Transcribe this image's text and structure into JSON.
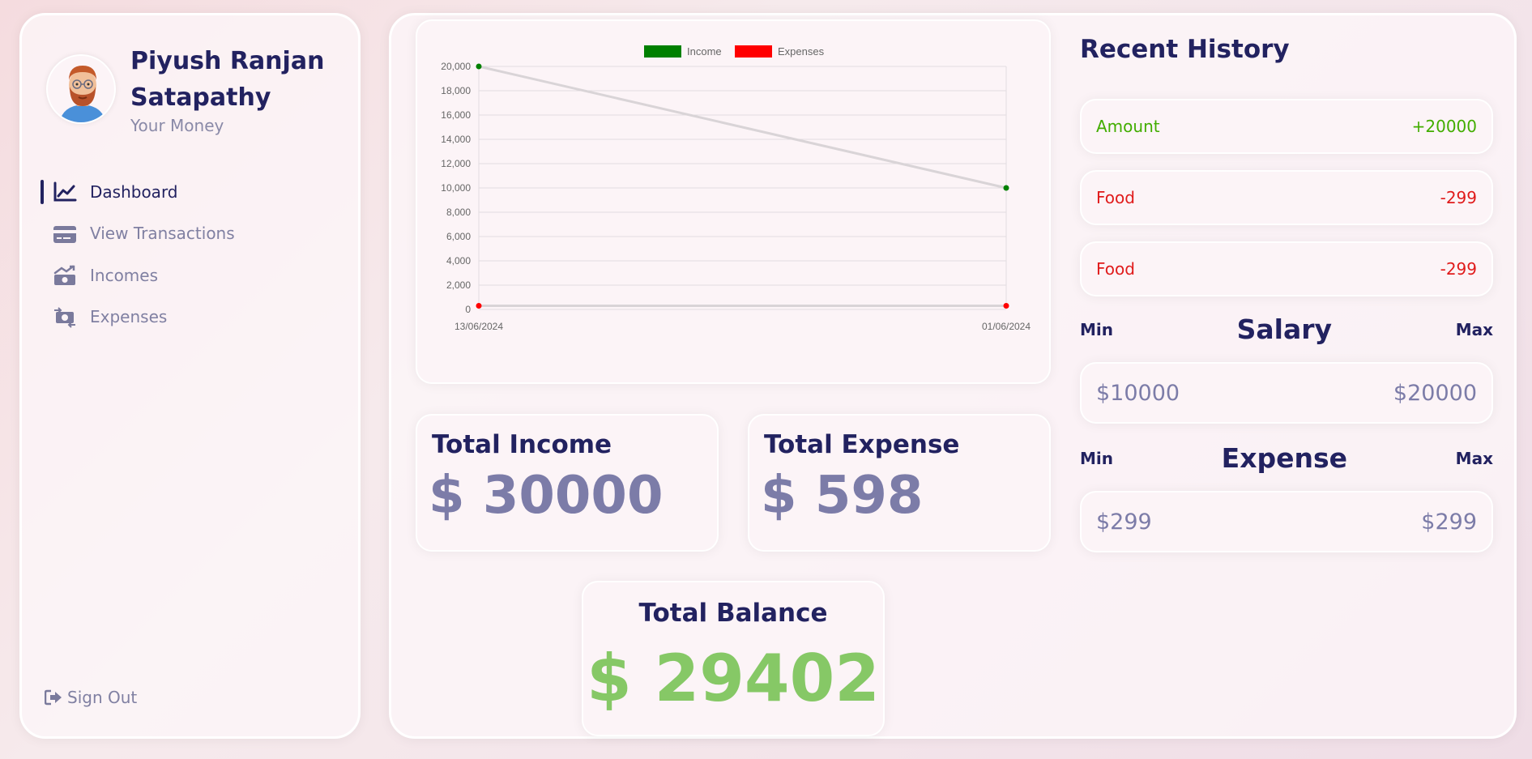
{
  "user": {
    "name": "Piyush Ranjan Satapathy",
    "subtitle": "Your Money"
  },
  "nav": [
    {
      "label": "Dashboard",
      "icon": "chart-line-icon",
      "active": true
    },
    {
      "label": "View Transactions",
      "icon": "credit-card-icon",
      "active": false
    },
    {
      "label": "Incomes",
      "icon": "money-trend-icon",
      "active": false
    },
    {
      "label": "Expenses",
      "icon": "money-exchange-icon",
      "active": false
    }
  ],
  "signout": {
    "label": "Sign Out",
    "icon": "sign-out-icon"
  },
  "chart_data": {
    "type": "line",
    "x": [
      "13/06/2024",
      "01/06/2024"
    ],
    "series": [
      {
        "name": "Income",
        "values": [
          20000,
          10000
        ],
        "color": "#008000"
      },
      {
        "name": "Expenses",
        "values": [
          299,
          299
        ],
        "color": "#ff0000"
      }
    ],
    "ylim": [
      0,
      20000
    ],
    "yticks": [
      "0",
      "2,000",
      "4,000",
      "6,000",
      "8,000",
      "10,000",
      "12,000",
      "14,000",
      "16,000",
      "18,000",
      "20,000"
    ],
    "grid": true,
    "legend": "top-center"
  },
  "stats": {
    "income": {
      "title": "Total Income",
      "value": "$ 30000"
    },
    "expense": {
      "title": "Total Expense",
      "value": "$ 598"
    },
    "balance": {
      "title": "Total Balance",
      "value": "$ 29402",
      "color": "#86c866"
    }
  },
  "history": {
    "title": "Recent History",
    "items": [
      {
        "label": "Amount",
        "amount": "+20000",
        "color": "#42ad00"
      },
      {
        "label": "Food",
        "amount": "-299",
        "color": "#e01b1b"
      },
      {
        "label": "Food",
        "amount": "-299",
        "color": "#e01b1b"
      }
    ]
  },
  "salary": {
    "title": "Salary",
    "min_label": "Min",
    "max_label": "Max",
    "min": "$10000",
    "max": "$20000"
  },
  "expense_range": {
    "title": "Expense",
    "min_label": "Min",
    "max_label": "Max",
    "min": "$299",
    "max": "$299"
  }
}
